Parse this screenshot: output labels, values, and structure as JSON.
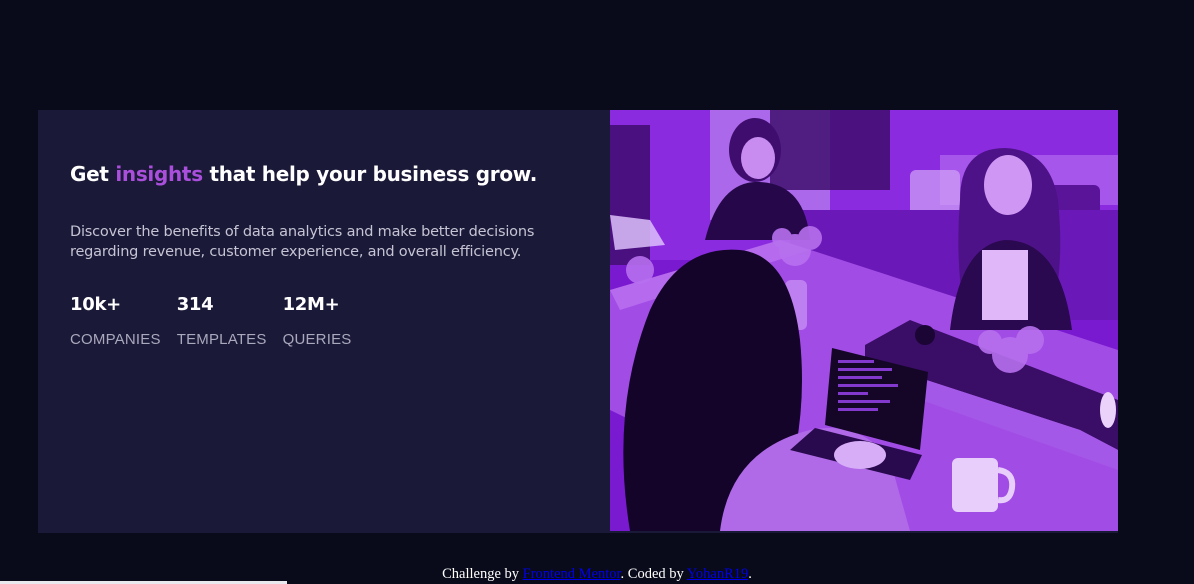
{
  "hero": {
    "title_before": "Get",
    "title_accent": "insights",
    "title_after": "that help your business grow.",
    "description": "Discover the benefits of data analytics and make better decisions regarding revenue, customer experience, and overall efficiency.",
    "stats": [
      {
        "value": "10k+",
        "label": "COMPANIES"
      },
      {
        "value": "314",
        "label": "TEMPLATES"
      },
      {
        "value": "12M+",
        "label": "QUERIES"
      }
    ]
  },
  "image": {
    "subject": "people working with laptops at a table, purple tint"
  },
  "footer": {
    "text_1": "Challenge by",
    "link_1": "Frontend Mentor",
    "text_2": ". Coded by",
    "link_2": "YohanR19",
    "text_3": "."
  },
  "colors": {
    "page_background": "#090b1a",
    "card_background": "#1b1938",
    "accent": "#a94fdc",
    "image_tint": "#7a1ad0",
    "heading": "#ffffff",
    "body_text": "#c5c4d4",
    "stat_label": "#a9a8bc",
    "link": "#0000ee"
  }
}
